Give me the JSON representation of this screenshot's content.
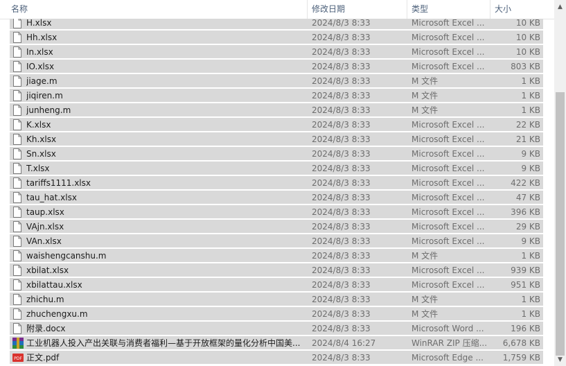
{
  "columns": {
    "name": "名称",
    "date": "修改日期",
    "type": "类型",
    "size": "大小"
  },
  "sort_indicator": "^",
  "scroll_up": "▲",
  "scroll_down": "▼",
  "files": [
    {
      "name": "H.xlsx",
      "date": "2024/8/3 8:33",
      "type": "Microsoft Excel ...",
      "size": "10 KB",
      "icon": "file-icon"
    },
    {
      "name": "Hh.xlsx",
      "date": "2024/8/3 8:33",
      "type": "Microsoft Excel ...",
      "size": "10 KB",
      "icon": "file-icon"
    },
    {
      "name": "In.xlsx",
      "date": "2024/8/3 8:33",
      "type": "Microsoft Excel ...",
      "size": "10 KB",
      "icon": "file-icon"
    },
    {
      "name": "IO.xlsx",
      "date": "2024/8/3 8:33",
      "type": "Microsoft Excel ...",
      "size": "803 KB",
      "icon": "file-icon"
    },
    {
      "name": "jiage.m",
      "date": "2024/8/3 8:33",
      "type": "M 文件",
      "size": "1 KB",
      "icon": "file-icon"
    },
    {
      "name": "jiqiren.m",
      "date": "2024/8/3 8:33",
      "type": "M 文件",
      "size": "1 KB",
      "icon": "file-icon"
    },
    {
      "name": "junheng.m",
      "date": "2024/8/3 8:33",
      "type": "M 文件",
      "size": "1 KB",
      "icon": "file-icon"
    },
    {
      "name": "K.xlsx",
      "date": "2024/8/3 8:33",
      "type": "Microsoft Excel ...",
      "size": "22 KB",
      "icon": "file-icon"
    },
    {
      "name": "Kh.xlsx",
      "date": "2024/8/3 8:33",
      "type": "Microsoft Excel ...",
      "size": "21 KB",
      "icon": "file-icon"
    },
    {
      "name": "Sn.xlsx",
      "date": "2024/8/3 8:33",
      "type": "Microsoft Excel ...",
      "size": "9 KB",
      "icon": "file-icon"
    },
    {
      "name": "T.xlsx",
      "date": "2024/8/3 8:33",
      "type": "Microsoft Excel ...",
      "size": "9 KB",
      "icon": "file-icon"
    },
    {
      "name": "tariffs1111.xlsx",
      "date": "2024/8/3 8:33",
      "type": "Microsoft Excel ...",
      "size": "422 KB",
      "icon": "file-icon"
    },
    {
      "name": "tau_hat.xlsx",
      "date": "2024/8/3 8:33",
      "type": "Microsoft Excel ...",
      "size": "47 KB",
      "icon": "file-icon"
    },
    {
      "name": "taup.xlsx",
      "date": "2024/8/3 8:33",
      "type": "Microsoft Excel ...",
      "size": "396 KB",
      "icon": "file-icon"
    },
    {
      "name": "VAjn.xlsx",
      "date": "2024/8/3 8:33",
      "type": "Microsoft Excel ...",
      "size": "29 KB",
      "icon": "file-icon"
    },
    {
      "name": "VAn.xlsx",
      "date": "2024/8/3 8:33",
      "type": "Microsoft Excel ...",
      "size": "9 KB",
      "icon": "file-icon"
    },
    {
      "name": "waishengcanshu.m",
      "date": "2024/8/3 8:33",
      "type": "M 文件",
      "size": "1 KB",
      "icon": "file-icon"
    },
    {
      "name": "xbilat.xlsx",
      "date": "2024/8/3 8:33",
      "type": "Microsoft Excel ...",
      "size": "939 KB",
      "icon": "file-icon"
    },
    {
      "name": "xbilattau.xlsx",
      "date": "2024/8/3 8:33",
      "type": "Microsoft Excel ...",
      "size": "951 KB",
      "icon": "file-icon"
    },
    {
      "name": "zhichu.m",
      "date": "2024/8/3 8:33",
      "type": "M 文件",
      "size": "1 KB",
      "icon": "file-icon"
    },
    {
      "name": "zhuchengxu.m",
      "date": "2024/8/3 8:33",
      "type": "M 文件",
      "size": "1 KB",
      "icon": "file-icon"
    },
    {
      "name": "附录.docx",
      "date": "2024/8/3 8:33",
      "type": "Microsoft Word ...",
      "size": "196 KB",
      "icon": "file-icon"
    },
    {
      "name": "工业机器人投入产出关联与消费者福利—基于开放框架的量化分析中国美...",
      "date": "2024/8/4 16:27",
      "type": "WinRAR ZIP 压缩...",
      "size": "6,678 KB",
      "icon": "winrar-icon"
    },
    {
      "name": "正文.pdf",
      "date": "2024/8/3 8:33",
      "type": "Microsoft Edge ...",
      "size": "1,759 KB",
      "icon": "pdf-icon"
    }
  ],
  "pdf_badge": "PDF",
  "colors": {
    "selected_row": "#d9d9d9",
    "header_text": "#4c607a",
    "winrar_red": "#b22222",
    "pdf_red": "#d9322d"
  }
}
